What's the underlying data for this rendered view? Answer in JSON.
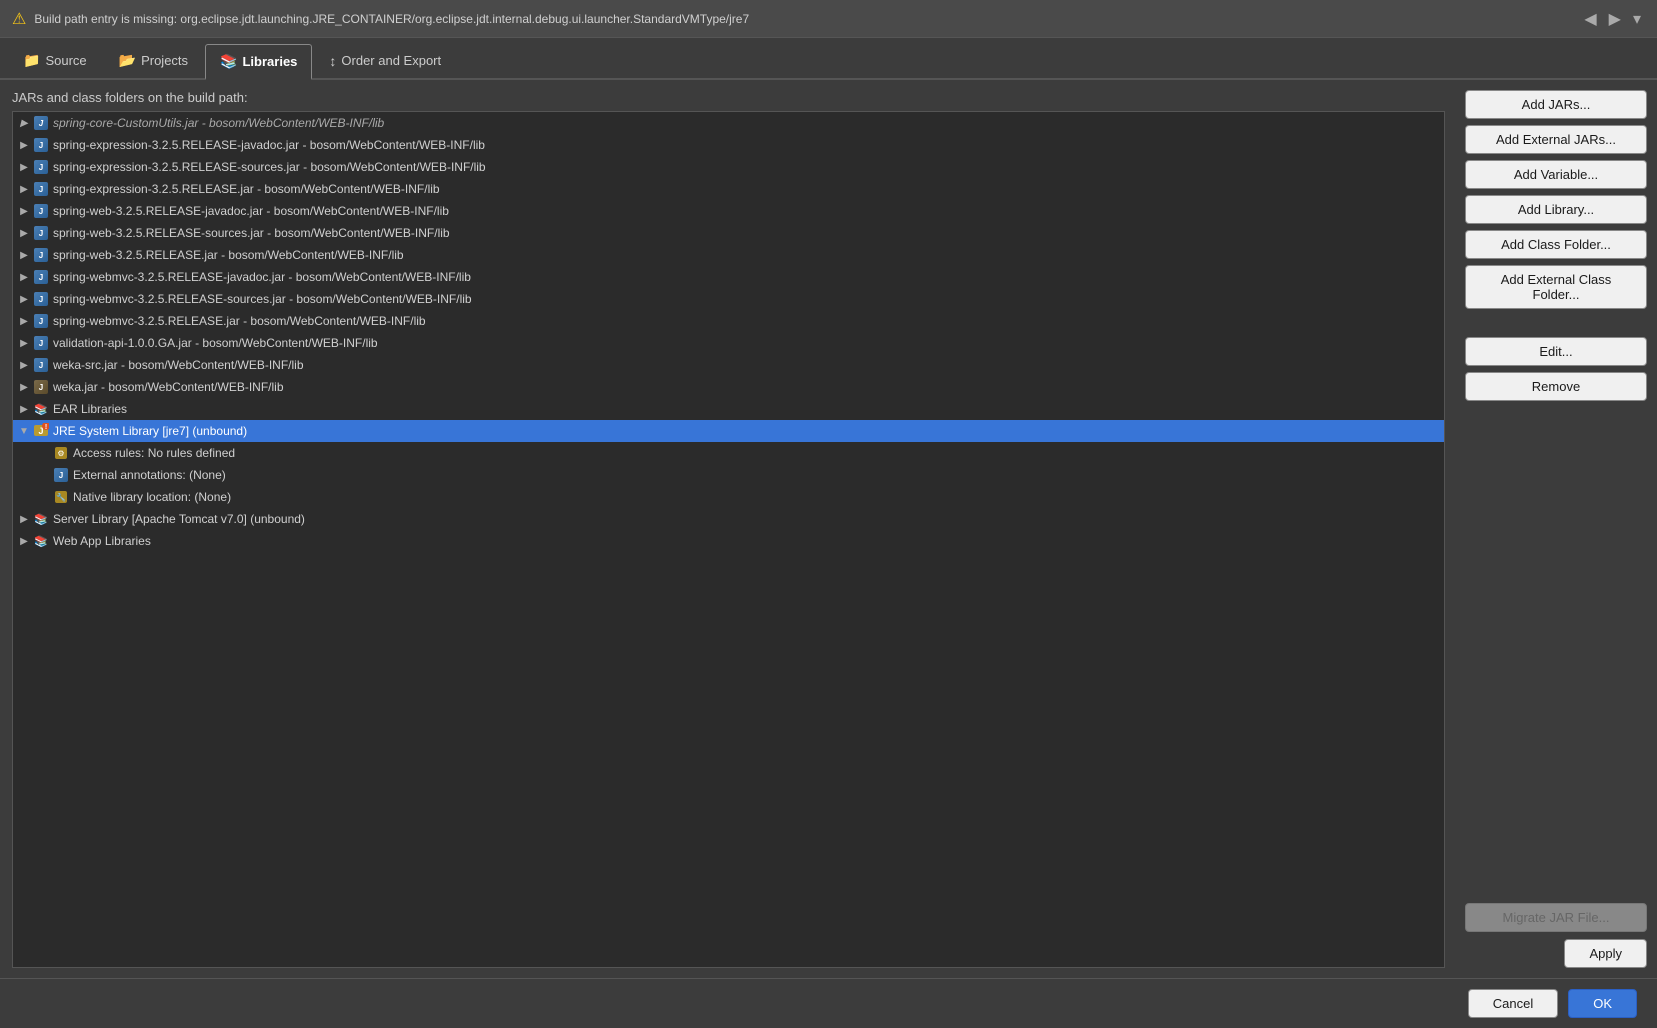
{
  "warning": {
    "text": "Build path entry is missing: org.eclipse.jdt.launching.JRE_CONTAINER/org.eclipse.jdt.internal.debug.ui.launcher.StandardVMType/jre7"
  },
  "tabs": [
    {
      "id": "source",
      "label": "Source",
      "icon": "📁",
      "active": false
    },
    {
      "id": "projects",
      "label": "Projects",
      "icon": "📂",
      "active": false
    },
    {
      "id": "libraries",
      "label": "Libraries",
      "icon": "📚",
      "active": true
    },
    {
      "id": "order-export",
      "label": "Order and Export",
      "icon": "↕",
      "active": false
    }
  ],
  "panel": {
    "label": "JARs and class folders on the build path:"
  },
  "tree": {
    "items": [
      {
        "id": "spring-coll-cut",
        "level": 1,
        "toggle": "▶",
        "icon": "jar",
        "label": "spring-core-CustomUtils.jar - bosom/WebContent/WEB-INF/lib",
        "selected": false,
        "visible": true,
        "partial": true
      },
      {
        "id": "spring-expr-javadoc",
        "level": 1,
        "toggle": "▶",
        "icon": "jar",
        "label": "spring-expression-3.2.5.RELEASE-javadoc.jar - bosom/WebContent/WEB-INF/lib",
        "selected": false,
        "visible": true
      },
      {
        "id": "spring-expr-sources",
        "level": 1,
        "toggle": "▶",
        "icon": "jar",
        "label": "spring-expression-3.2.5.RELEASE-sources.jar - bosom/WebContent/WEB-INF/lib",
        "selected": false,
        "visible": true
      },
      {
        "id": "spring-expr",
        "level": 1,
        "toggle": "▶",
        "icon": "jar",
        "label": "spring-expression-3.2.5.RELEASE.jar - bosom/WebContent/WEB-INF/lib",
        "selected": false,
        "visible": true
      },
      {
        "id": "spring-web-javadoc",
        "level": 1,
        "toggle": "▶",
        "icon": "jar",
        "label": "spring-web-3.2.5.RELEASE-javadoc.jar - bosom/WebContent/WEB-INF/lib",
        "selected": false,
        "visible": true
      },
      {
        "id": "spring-web-sources",
        "level": 1,
        "toggle": "▶",
        "icon": "jar",
        "label": "spring-web-3.2.5.RELEASE-sources.jar - bosom/WebContent/WEB-INF/lib",
        "selected": false,
        "visible": true
      },
      {
        "id": "spring-web",
        "level": 1,
        "toggle": "▶",
        "icon": "jar",
        "label": "spring-web-3.2.5.RELEASE.jar - bosom/WebContent/WEB-INF/lib",
        "selected": false,
        "visible": true
      },
      {
        "id": "spring-webmvc-javadoc",
        "level": 1,
        "toggle": "▶",
        "icon": "jar",
        "label": "spring-webmvc-3.2.5.RELEASE-javadoc.jar - bosom/WebContent/WEB-INF/lib",
        "selected": false,
        "visible": true
      },
      {
        "id": "spring-webmvc-sources",
        "level": 1,
        "toggle": "▶",
        "icon": "jar",
        "label": "spring-webmvc-3.2.5.RELEASE-sources.jar - bosom/WebContent/WEB-INF/lib",
        "selected": false,
        "visible": true
      },
      {
        "id": "spring-webmvc",
        "level": 1,
        "toggle": "▶",
        "icon": "jar",
        "label": "spring-webmvc-3.2.5.RELEASE.jar - bosom/WebContent/WEB-INF/lib",
        "selected": false,
        "visible": true
      },
      {
        "id": "validation-api",
        "level": 1,
        "toggle": "▶",
        "icon": "jar",
        "label": "validation-api-1.0.0.GA.jar - bosom/WebContent/WEB-INF/lib",
        "selected": false,
        "visible": true
      },
      {
        "id": "weka-src",
        "level": 1,
        "toggle": "▶",
        "icon": "jar",
        "label": "weka-src.jar - bosom/WebContent/WEB-INF/lib",
        "selected": false,
        "visible": true
      },
      {
        "id": "weka",
        "level": 1,
        "toggle": "▶",
        "icon": "jar2",
        "label": "weka.jar - bosom/WebContent/WEB-INF/lib",
        "selected": false,
        "visible": true
      },
      {
        "id": "ear-libs",
        "level": 1,
        "toggle": "▶",
        "icon": "lib",
        "label": "EAR Libraries",
        "selected": false,
        "visible": true
      },
      {
        "id": "jre-system",
        "level": 1,
        "toggle": "▼",
        "icon": "jre-warn",
        "label": "JRE System Library [jre7] (unbound)",
        "selected": true,
        "visible": true
      },
      {
        "id": "access-rules",
        "level": 2,
        "toggle": "",
        "icon": "access",
        "label": "Access rules: No rules defined",
        "selected": false,
        "visible": true
      },
      {
        "id": "ext-annotations",
        "level": 2,
        "toggle": "",
        "icon": "jar",
        "label": "External annotations: (None)",
        "selected": false,
        "visible": true
      },
      {
        "id": "native-lib",
        "level": 2,
        "toggle": "",
        "icon": "native",
        "label": "Native library location: (None)",
        "selected": false,
        "visible": true
      },
      {
        "id": "server-lib",
        "level": 1,
        "toggle": "▶",
        "icon": "lib",
        "label": "Server Library [Apache Tomcat v7.0] (unbound)",
        "selected": false,
        "visible": true
      },
      {
        "id": "webapp-libs",
        "level": 1,
        "toggle": "▶",
        "icon": "lib",
        "label": "Web App Libraries",
        "selected": false,
        "visible": true
      }
    ]
  },
  "buttons": {
    "add_jars": "Add JARs...",
    "add_external_jars": "Add External JARs...",
    "add_variable": "Add Variable...",
    "add_library": "Add Library...",
    "add_class_folder": "Add Class Folder...",
    "add_external_class_folder": "Add External Class Folder...",
    "edit": "Edit...",
    "remove": "Remove",
    "migrate_jar": "Migrate JAR File...",
    "apply": "Apply",
    "cancel": "Cancel",
    "ok": "OK"
  }
}
